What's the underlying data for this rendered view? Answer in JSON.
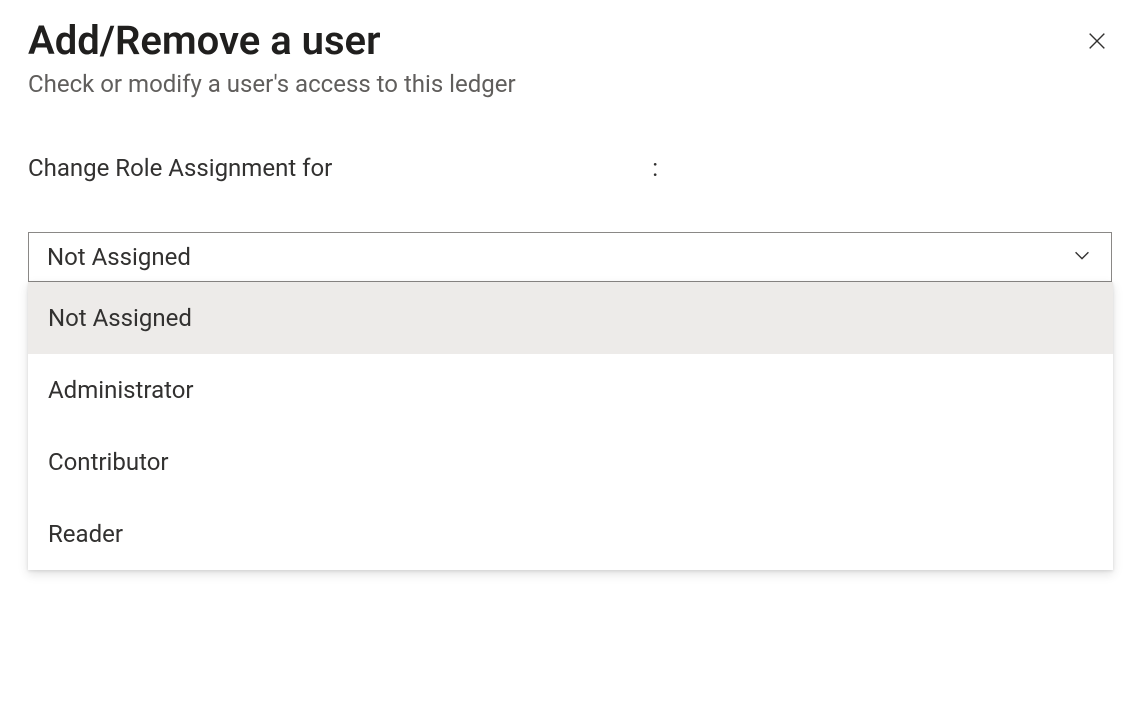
{
  "panel": {
    "title": "Add/Remove a user",
    "subtitle": "Check or modify a user's access to this ledger"
  },
  "form": {
    "label_prefix": "Change Role Assignment for",
    "label_user": "",
    "label_suffix": ":"
  },
  "roleSelect": {
    "selected": "Not Assigned",
    "options": [
      {
        "label": "Not Assigned",
        "selected": true
      },
      {
        "label": "Administrator",
        "selected": false
      },
      {
        "label": "Contributor",
        "selected": false
      },
      {
        "label": "Reader",
        "selected": false
      }
    ]
  }
}
